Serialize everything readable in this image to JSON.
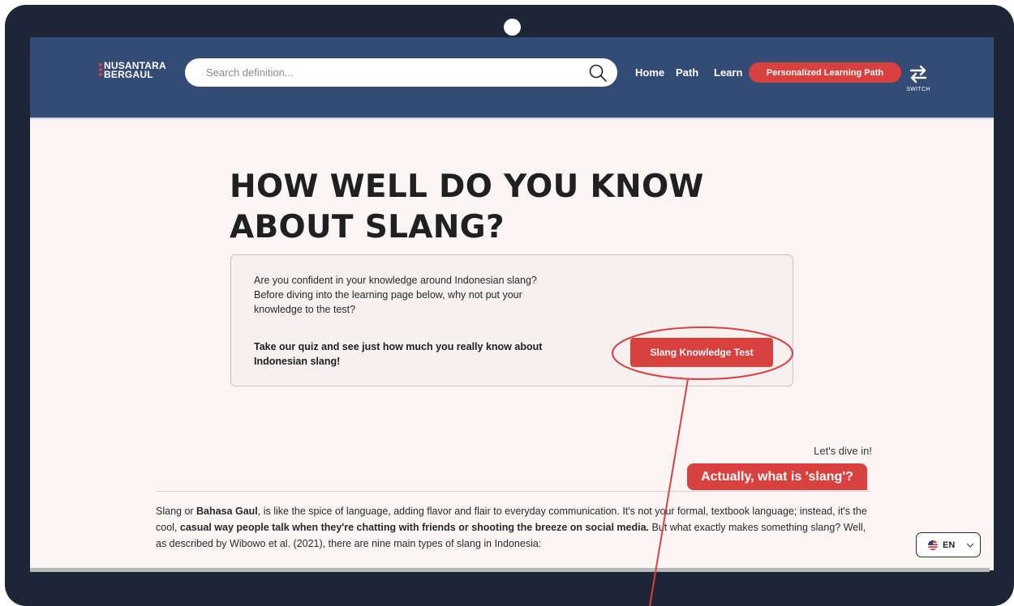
{
  "header": {
    "logo_line1": "NUSANTARA",
    "logo_line2": "BERGAUL",
    "search_placeholder": "Search definition...",
    "nav": [
      "Home",
      "Path",
      "Learn"
    ],
    "cta_label": "Personalized Learning Path",
    "switch_label": "SWITCH"
  },
  "hero": {
    "title_line1": "HOW WELL DO YOU KNOW",
    "title_line2": "ABOUT SLANG?",
    "card_text": "Are you confident in your knowledge around Indonesian slang? Before diving into the learning page below, why not put your knowledge to the test?",
    "card_strong": "Take our quiz and see just how much you really know about Indonesian slang!",
    "test_button": "Slang Knowledge Test"
  },
  "intro": {
    "dive_text": "Let's dive in!",
    "badge": "Actually, what is 'slang'?",
    "paragraph": {
      "p1": "Slang or ",
      "b1": "Bahasa Gaul",
      "p2": ", is like the spice of language, adding flavor and flair to everyday communication. It's not your formal, textbook language; instead, it's the cool, ",
      "b2": "casual way people talk when they're chatting with friends or shooting the breeze on social media.",
      "p3": " But what exactly makes something slang? Well, as described by Wibowo et al. (2021), there are nine main types of slang in Indonesia:"
    }
  },
  "language": {
    "code": "EN",
    "flag_icon": "us-flag-icon"
  },
  "colors": {
    "header_bg": "#344b76",
    "accent": "#d8413d",
    "page_bg": "#fbf6f5",
    "frame": "#1d2637"
  }
}
